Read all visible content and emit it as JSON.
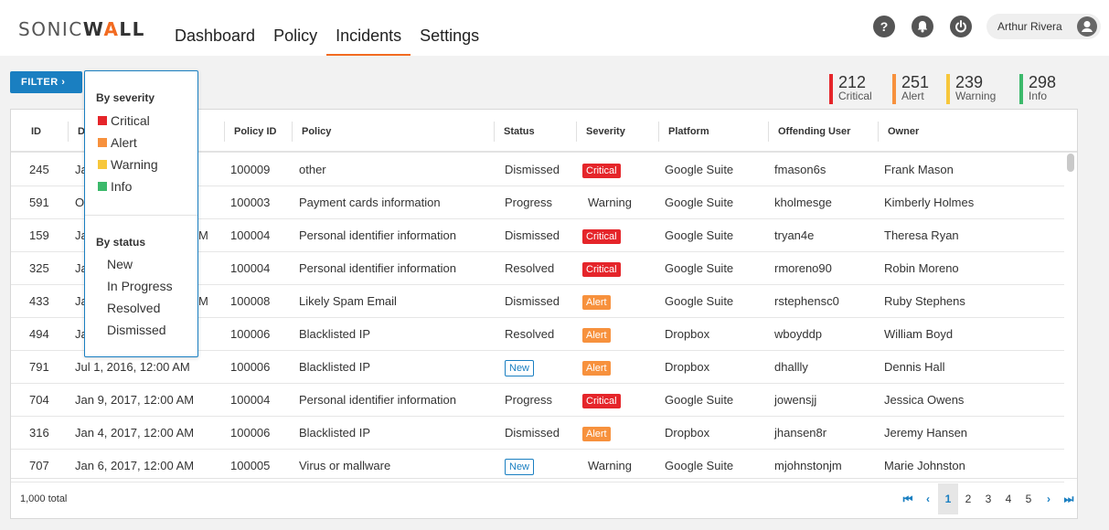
{
  "brand": {
    "logo_a": "SONIC",
    "logo_b": "W",
    "logo_slash": "A",
    "logo_c": "LL"
  },
  "nav": [
    {
      "label": "Dashboard"
    },
    {
      "label": "Policy"
    },
    {
      "label": "Incidents",
      "active": true
    },
    {
      "label": "Settings"
    }
  ],
  "header_icons": [
    "help-icon",
    "notifications-bell-icon",
    "power-icon"
  ],
  "user": {
    "name": "Arthur Rivera"
  },
  "filter": {
    "label": "FILTER ›"
  },
  "counters": [
    {
      "value": "212",
      "label": "Critical",
      "color": "#e5252a"
    },
    {
      "value": "251",
      "label": "Alert",
      "color": "#f7913d"
    },
    {
      "value": "239",
      "label": "Warning",
      "color": "#f7c73b"
    },
    {
      "value": "298",
      "label": "Info",
      "color": "#3cb96b"
    }
  ],
  "dropdown": {
    "severity_heading": "By severity",
    "severity": [
      {
        "label": "Critical",
        "color": "#e5252a"
      },
      {
        "label": "Alert",
        "color": "#f7913d"
      },
      {
        "label": "Warning",
        "color": "#f7c73b"
      },
      {
        "label": "Info",
        "color": "#3cb96b"
      }
    ],
    "status_heading": "By status",
    "status": [
      "New",
      "In Progress",
      "Resolved",
      "Dismissed"
    ]
  },
  "table": {
    "columns": [
      "ID",
      "D",
      "Policy ID",
      "Policy",
      "Status",
      "Severity",
      "Platform",
      "Offending User",
      "Owner"
    ],
    "rows": [
      {
        "id": "245",
        "date": "Ja",
        "policy_id": "100009",
        "policy": "other",
        "status": "Dismissed",
        "severity": "Critical",
        "platform": "Google Suite",
        "user": "fmason6s",
        "owner": "Frank Mason"
      },
      {
        "id": "591",
        "date": "O",
        "policy_id": "100003",
        "policy": "Payment cards information",
        "status": "Progress",
        "severity": "Warning",
        "platform": "Google Suite",
        "user": "kholmesge",
        "owner": "Kimberly Holmes"
      },
      {
        "id": "159",
        "date": "Ja",
        "date_tail": "M",
        "policy_id": "100004",
        "policy": "Personal identifier information",
        "status": "Dismissed",
        "severity": "Critical",
        "platform": "Google Suite",
        "user": "tryan4e",
        "owner": "Theresa Ryan"
      },
      {
        "id": "325",
        "date": "Ja",
        "policy_id": "100004",
        "policy": "Personal identifier information",
        "status": "Resolved",
        "severity": "Critical",
        "platform": "Google Suite",
        "user": "rmoreno90",
        "owner": "Robin Moreno"
      },
      {
        "id": "433",
        "date": "Ja",
        "date_tail": "M",
        "policy_id": "100008",
        "policy": "Likely Spam Email",
        "status": "Dismissed",
        "severity": "Alert",
        "platform": "Google Suite",
        "user": "rstephensc0",
        "owner": "Ruby Stephens"
      },
      {
        "id": "494",
        "date": "Ja",
        "policy_id": "100006",
        "policy": "Blacklisted IP",
        "status": "Resolved",
        "severity": "Alert",
        "platform": "Dropbox",
        "user": "wboyddp",
        "owner": "William Boyd"
      },
      {
        "id": "791",
        "date": "Jul 1, 2016, 12:00 AM",
        "policy_id": "100006",
        "policy": "Blacklisted IP",
        "status": "New",
        "severity": "Alert",
        "platform": "Dropbox",
        "user": "dhallly",
        "owner": "Dennis Hall"
      },
      {
        "id": "704",
        "date": "Jan 9, 2017, 12:00 AM",
        "policy_id": "100004",
        "policy": "Personal identifier information",
        "status": "Progress",
        "severity": "Critical",
        "platform": "Google Suite",
        "user": "jowensjj",
        "owner": "Jessica Owens"
      },
      {
        "id": "316",
        "date": "Jan 4, 2017, 12:00 AM",
        "policy_id": "100006",
        "policy": "Blacklisted IP",
        "status": "Dismissed",
        "severity": "Alert",
        "platform": "Dropbox",
        "user": "jhansen8r",
        "owner": "Jeremy Hansen"
      },
      {
        "id": "707",
        "date": "Jan 6, 2017, 12:00 AM",
        "policy_id": "100005",
        "policy": "Virus or mallware",
        "status": "New",
        "severity": "Warning",
        "platform": "Google Suite",
        "user": "mjohnstonjm",
        "owner": "Marie Johnston"
      }
    ]
  },
  "footer": {
    "total": "1,000 total",
    "pages": [
      "1",
      "2",
      "3",
      "4",
      "5"
    ],
    "current_page": "1",
    "first_glyph": "⏮",
    "prev_glyph": "‹",
    "next_glyph": "›",
    "last_glyph": "⏭"
  }
}
